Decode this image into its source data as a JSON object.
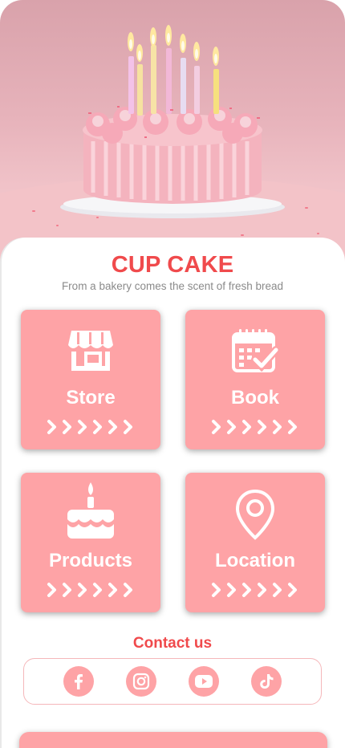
{
  "hero": {
    "image": "birthday-cake-with-candles"
  },
  "header": {
    "title": "CUP CAKE",
    "subtitle": "From a bakery comes the scent of fresh bread"
  },
  "tiles": [
    {
      "label": "Store",
      "icon": "store-icon"
    },
    {
      "label": "Book",
      "icon": "calendar-check-icon"
    },
    {
      "label": "Products",
      "icon": "cake-icon"
    },
    {
      "label": "Location",
      "icon": "map-pin-icon"
    }
  ],
  "contact": {
    "title": "Contact us",
    "socials": [
      "facebook-icon",
      "instagram-icon",
      "youtube-icon",
      "tiktok-icon"
    ]
  },
  "colors": {
    "accent": "#f04a4c",
    "tile": "#fea3a6",
    "subtitle": "#8a8a8a"
  }
}
